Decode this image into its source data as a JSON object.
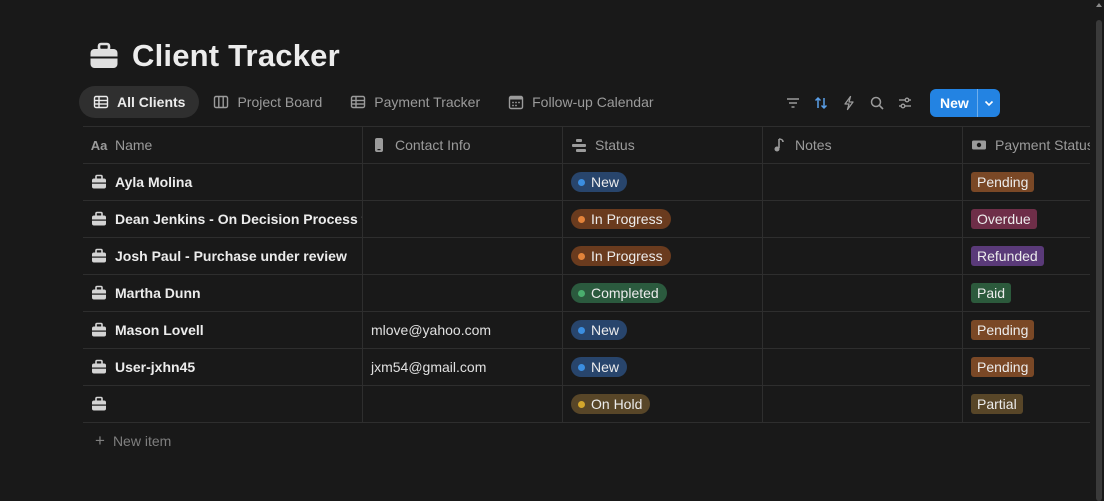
{
  "page": {
    "title": "Client Tracker",
    "icon": "briefcase-icon"
  },
  "tabs": [
    {
      "label": "All Clients",
      "icon": "table-icon",
      "active": true
    },
    {
      "label": "Project Board",
      "icon": "board-icon",
      "active": false
    },
    {
      "label": "Payment Tracker",
      "icon": "table-icon",
      "active": false
    },
    {
      "label": "Follow-up Calendar",
      "icon": "calendar-icon",
      "active": false
    }
  ],
  "toolbar": {
    "icons": [
      "filter-icon",
      "sort-icon",
      "automation-icon",
      "search-icon",
      "settings-icon"
    ],
    "new_label": "New",
    "accent": "#2383e2",
    "sort_active_color": "#5a9fe8"
  },
  "columns": [
    {
      "label": "Name",
      "icon": "text-type-icon"
    },
    {
      "label": "Contact Info",
      "icon": "phone-icon"
    },
    {
      "label": "Status",
      "icon": "status-icon"
    },
    {
      "label": "Notes",
      "icon": "music-note-icon"
    },
    {
      "label": "Payment Status",
      "icon": "money-icon"
    }
  ],
  "rows": [
    {
      "name": "Ayla Molina",
      "contact": "",
      "status": "New",
      "notes": "",
      "payment": "Pending"
    },
    {
      "name": "Dean Jenkins - On Decision Process for",
      "contact": "",
      "status": "In Progress",
      "notes": "",
      "payment": "Overdue"
    },
    {
      "name": "Josh Paul - Purchase under review",
      "contact": "",
      "status": "In Progress",
      "notes": "",
      "payment": "Refunded"
    },
    {
      "name": "Martha Dunn",
      "contact": "",
      "status": "Completed",
      "notes": "",
      "payment": "Paid"
    },
    {
      "name": "Mason Lovell",
      "contact": "mlove@yahoo.com",
      "status": "New",
      "notes": "",
      "payment": "Pending"
    },
    {
      "name": "User-jxhn45",
      "contact": "jxm54@gmail.com",
      "status": "New",
      "notes": "",
      "payment": "Pending"
    },
    {
      "name": "",
      "contact": "",
      "status": "On Hold",
      "notes": "",
      "payment": "Partial"
    }
  ],
  "status_colors": {
    "New": {
      "bg": "#28456c",
      "dot": "#3b8ee0"
    },
    "In Progress": {
      "bg": "#6a3b1e",
      "dot": "#e3833a"
    },
    "Completed": {
      "bg": "#2b5a3e",
      "dot": "#4aae6e"
    },
    "On Hold": {
      "bg": "#584628",
      "dot": "#d4a72c"
    }
  },
  "payment_colors": {
    "Pending": "#7a4826",
    "Overdue": "#6e2e48",
    "Refunded": "#5a3a79",
    "Paid": "#2c5a3c",
    "Partial": "#584628"
  },
  "new_item_label": "New item"
}
